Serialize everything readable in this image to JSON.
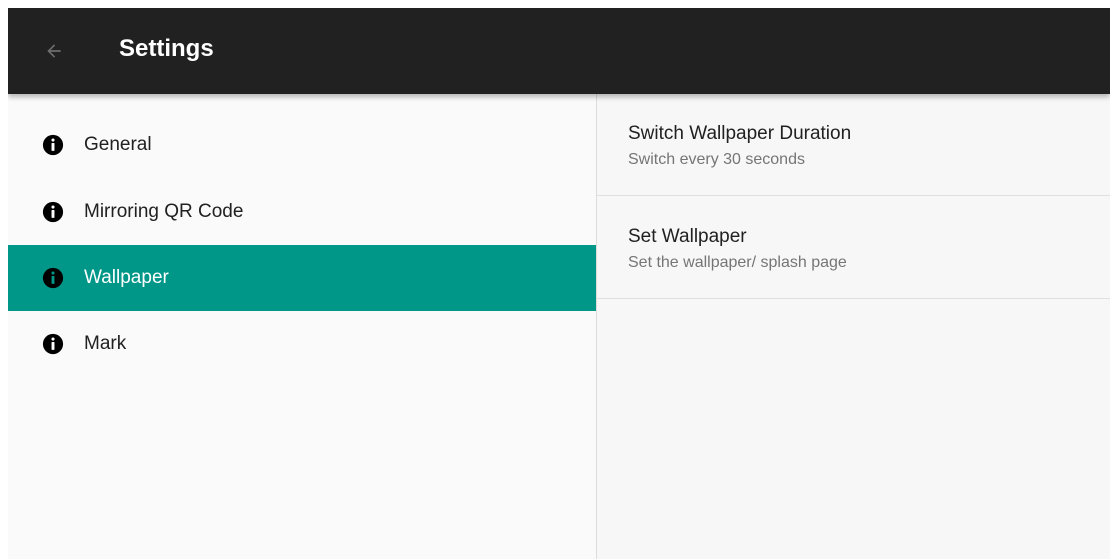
{
  "app_bar": {
    "title": "Settings",
    "back_icon": "arrow-back-icon",
    "background": "#212121"
  },
  "sidebar": {
    "selected_index": 2,
    "accent": "#009688",
    "items": [
      {
        "label": "General",
        "icon": "info-icon"
      },
      {
        "label": "Mirroring QR Code",
        "icon": "info-icon"
      },
      {
        "label": "Wallpaper",
        "icon": "info-icon"
      },
      {
        "label": "Mark",
        "icon": "info-icon"
      }
    ]
  },
  "preferences": [
    {
      "title": "Switch Wallpaper Duration",
      "summary": "Switch every 30 seconds"
    },
    {
      "title": "Set Wallpaper",
      "summary": "Set the wallpaper/ splash page"
    }
  ]
}
